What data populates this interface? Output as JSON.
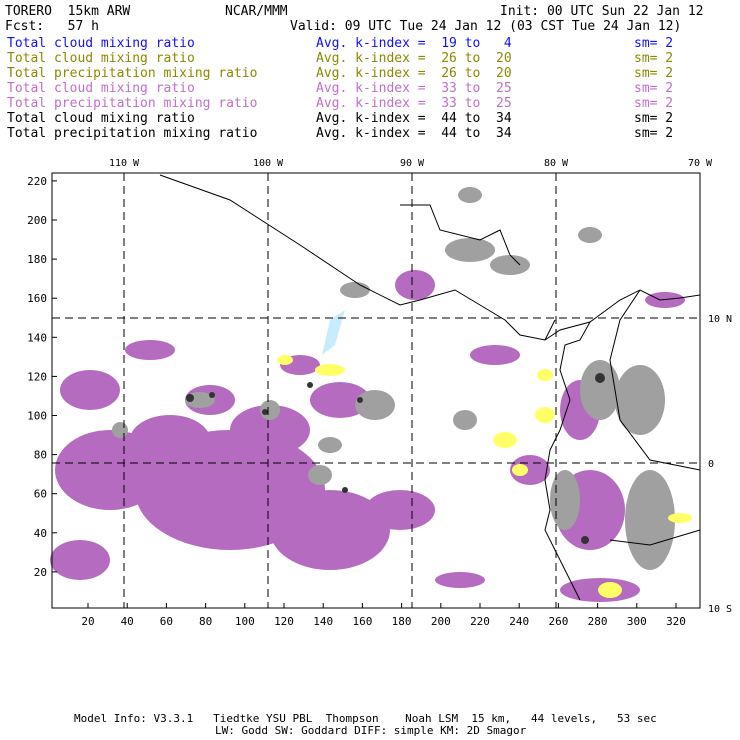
{
  "header": {
    "model": "TORERO  15km ARW",
    "org": "NCAR/MMM",
    "init": "Init: 00 UTC Sun 22 Jan 12",
    "fcst": "Fcst:   57 h",
    "valid": "Valid: 09 UTC Tue 24 Jan 12 (03 CST Tue 24 Jan 12)"
  },
  "legend": [
    {
      "field": "Total cloud mixing ratio",
      "kindex": "Avg. k-index =  19 to   4",
      "sm": "sm= 2",
      "color": "#1010ff"
    },
    {
      "field": "Total cloud mixing ratio",
      "kindex": "Avg. k-index =  26 to  20",
      "sm": "sm= 2",
      "color": "#8a8a00"
    },
    {
      "field": "Total precipitation mixing ratio",
      "kindex": "Avg. k-index =  26 to  20",
      "sm": "sm= 2",
      "color": "#8a8a00"
    },
    {
      "field": "Total cloud mixing ratio",
      "kindex": "Avg. k-index =  33 to  25",
      "sm": "sm= 2",
      "color": "#c070c8"
    },
    {
      "field": "Total precipitation mixing ratio",
      "kindex": "Avg. k-index =  33 to  25",
      "sm": "sm= 2",
      "color": "#c070c8"
    },
    {
      "field": "Total cloud mixing ratio",
      "kindex": "Avg. k-index =  44 to  34",
      "sm": "sm= 2",
      "color": "#000000"
    },
    {
      "field": "Total precipitation mixing ratio",
      "kindex": "Avg. k-index =  44 to  34",
      "sm": "sm= 2",
      "color": "#000000"
    }
  ],
  "map": {
    "x_ticks": [
      20,
      40,
      60,
      80,
      100,
      120,
      140,
      160,
      180,
      200,
      220,
      240,
      260,
      280,
      300,
      320
    ],
    "y_ticks": [
      20,
      40,
      60,
      80,
      100,
      120,
      140,
      160,
      180,
      200,
      220
    ],
    "lon_labels": [
      "110 W",
      "100 W",
      "90 W",
      "80 W",
      "70 W"
    ],
    "lat_labels": [
      "10 N",
      "0",
      "10 S"
    ],
    "colors": {
      "purple": "#b56cc0",
      "gray": "#a0a0a0",
      "yellow": "#ffff66",
      "lightblue": "#c8ecff"
    }
  },
  "footer": {
    "line1": "Model Info: V3.3.1   Tiedtke YSU PBL  Thompson    Noah LSM  15 km,   44 levels,   53 sec",
    "line2": "LW: Godd SW: Goddard DIFF: simple KM: 2D Smagor"
  }
}
